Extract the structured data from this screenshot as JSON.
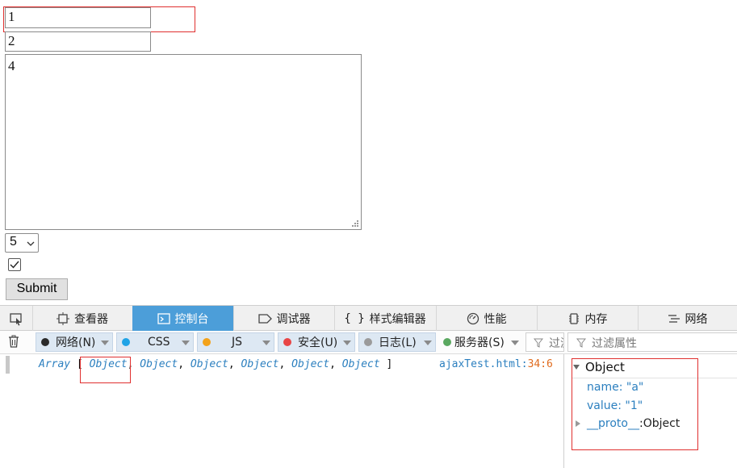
{
  "form": {
    "input1_value": "1",
    "input2_value": "2",
    "textarea_value": "4",
    "select_value": "5",
    "checkbox_checked": true,
    "submit_label": "Submit"
  },
  "devtools": {
    "tabs": [
      {
        "label": "查看器",
        "icon": "inspector-icon"
      },
      {
        "label": "控制台",
        "icon": "console-icon",
        "active": true
      },
      {
        "label": "调试器",
        "icon": "debugger-icon"
      },
      {
        "label": "样式编辑器",
        "icon": "braces-icon"
      },
      {
        "label": "性能",
        "icon": "performance-icon"
      },
      {
        "label": "内存",
        "icon": "memory-icon"
      },
      {
        "label": "网络",
        "icon": "network-icon"
      }
    ],
    "filters": [
      {
        "label": "网络(N)",
        "color": "#2a2a2a"
      },
      {
        "label": "CSS",
        "color": "#1fa3e6"
      },
      {
        "label": "JS",
        "color": "#f3a21a"
      },
      {
        "label": "安全(U)",
        "color": "#e84545"
      },
      {
        "label": "日志(L)",
        "color": "#9b9b9b"
      },
      {
        "label": "服务器(S)",
        "color": "#5aa860"
      }
    ],
    "filter_placeholder": "过滤",
    "props_filter_placeholder": "过滤属性",
    "log": {
      "prefix": "Array",
      "open_bracket": "[",
      "items": [
        "Object",
        "Object",
        "Object",
        "Object",
        "Object",
        "Object"
      ],
      "close_bracket": "]",
      "source_file": "ajaxTest.html",
      "source_loc": "34:6"
    },
    "inspector": {
      "title": "Object",
      "props": [
        {
          "key": "name",
          "value": "\"a\""
        },
        {
          "key": "value",
          "value": "\"1\""
        }
      ],
      "proto_key": "__proto__",
      "proto_value": "Object"
    }
  }
}
